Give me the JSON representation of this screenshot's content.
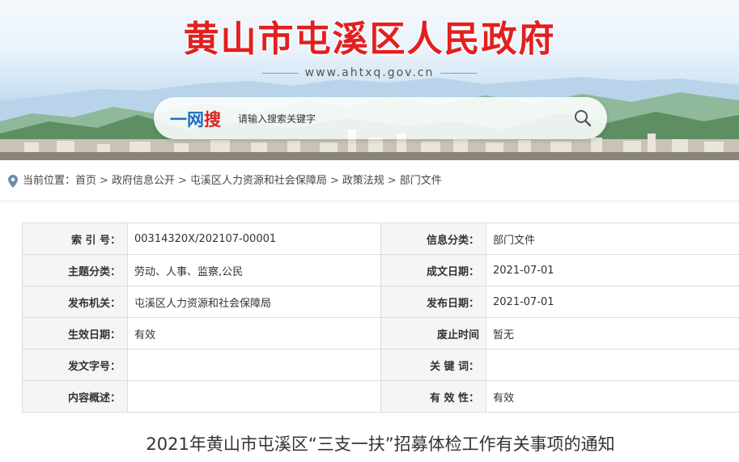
{
  "header": {
    "site_title": "黄山市屯溪区人民政府",
    "site_url": "www.ahtxq.gov.cn",
    "search": {
      "logo_part1": "一网",
      "logo_part2": "搜",
      "placeholder": "请输入搜索关键字",
      "value": ""
    }
  },
  "breadcrumb": {
    "prefix": "当前位置：",
    "items": [
      "首页",
      "政府信息公开",
      "屯溪区人力资源和社会保障局",
      "政策法规",
      "部门文件"
    ],
    "separator": ">"
  },
  "meta_table": {
    "rows": [
      {
        "label1": "索 引 号：",
        "value1": "00314320X/202107-00001",
        "label2": "信息分类：",
        "value2": "部门文件"
      },
      {
        "label1": "主题分类：",
        "value1": "劳动、人事、监察,公民",
        "label2": "成文日期：",
        "value2": "2021-07-01"
      },
      {
        "label1": "发布机关：",
        "value1": "屯溪区人力资源和社会保障局",
        "label2": "发布日期：",
        "value2": "2021-07-01"
      },
      {
        "label1": "生效日期：",
        "value1": "有效",
        "label2": "废止时间",
        "value2": "暂无"
      },
      {
        "label1": "发文字号：",
        "value1": "",
        "label2": "关 键 词：",
        "value2": ""
      },
      {
        "label1": "内容概述：",
        "value1": "",
        "label2": "有 效 性：",
        "value2": "有效"
      }
    ]
  },
  "document": {
    "title": "2021年黄山市屯溪区“三支一扶”招募体检工作有关事项的通知"
  },
  "colors": {
    "title_red": "#e21f1f",
    "logo_blue": "#1d6fc4",
    "label_bg": "#f5f5f5",
    "border": "#dcdcdc"
  },
  "icons": {
    "search": "search-icon",
    "location": "location-pin-icon"
  }
}
